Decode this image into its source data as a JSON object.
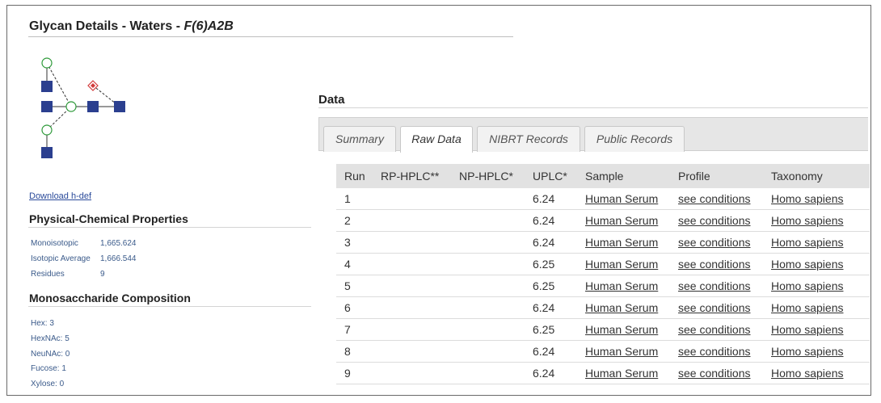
{
  "page": {
    "title_prefix": "Glycan Details - Waters - ",
    "title_glycan": "F(6)A2B",
    "download_link": "Download h-def"
  },
  "physchem": {
    "heading": "Physical-Chemical Properties",
    "rows": [
      {
        "label": "Monoisotopic",
        "value": "1,665.624"
      },
      {
        "label": "Isotopic Average",
        "value": "1,666.544"
      },
      {
        "label": "Residues",
        "value": "9"
      }
    ]
  },
  "composition": {
    "heading": "Monosaccharide Composition",
    "items": [
      "Hex: 3",
      "HexNAc: 5",
      "NeuNAc: 0",
      "Fucose: 1",
      "Xylose: 0"
    ]
  },
  "data_section": {
    "heading": "Data",
    "tabs": [
      {
        "label": "Summary",
        "active": false
      },
      {
        "label": "Raw Data",
        "active": true
      },
      {
        "label": "NIBRT Records",
        "active": false
      },
      {
        "label": "Public Records",
        "active": false
      }
    ],
    "columns": [
      "Run",
      "RP-HPLC**",
      "NP-HPLC*",
      "UPLC*",
      "Sample",
      "Profile",
      "Taxonomy"
    ],
    "rows": [
      {
        "run": "1",
        "rp": "",
        "np": "",
        "uplc": "6.24",
        "sample": "Human Serum",
        "profile": "see conditions",
        "taxonomy": "Homo sapiens"
      },
      {
        "run": "2",
        "rp": "",
        "np": "",
        "uplc": "6.24",
        "sample": "Human Serum",
        "profile": "see conditions",
        "taxonomy": "Homo sapiens"
      },
      {
        "run": "3",
        "rp": "",
        "np": "",
        "uplc": "6.24",
        "sample": "Human Serum",
        "profile": "see conditions",
        "taxonomy": "Homo sapiens"
      },
      {
        "run": "4",
        "rp": "",
        "np": "",
        "uplc": "6.25",
        "sample": "Human Serum",
        "profile": "see conditions",
        "taxonomy": "Homo sapiens"
      },
      {
        "run": "5",
        "rp": "",
        "np": "",
        "uplc": "6.25",
        "sample": "Human Serum",
        "profile": "see conditions",
        "taxonomy": "Homo sapiens"
      },
      {
        "run": "6",
        "rp": "",
        "np": "",
        "uplc": "6.24",
        "sample": "Human Serum",
        "profile": "see conditions",
        "taxonomy": "Homo sapiens"
      },
      {
        "run": "7",
        "rp": "",
        "np": "",
        "uplc": "6.25",
        "sample": "Human Serum",
        "profile": "see conditions",
        "taxonomy": "Homo sapiens"
      },
      {
        "run": "8",
        "rp": "",
        "np": "",
        "uplc": "6.24",
        "sample": "Human Serum",
        "profile": "see conditions",
        "taxonomy": "Homo sapiens"
      },
      {
        "run": "9",
        "rp": "",
        "np": "",
        "uplc": "6.24",
        "sample": "Human Serum",
        "profile": "see conditions",
        "taxonomy": "Homo sapiens"
      }
    ]
  },
  "colors": {
    "glcnac_square": "#2b3f8f",
    "mannose_circle": "#2e9a3a",
    "fucose_diamond": "#d23b3b"
  }
}
